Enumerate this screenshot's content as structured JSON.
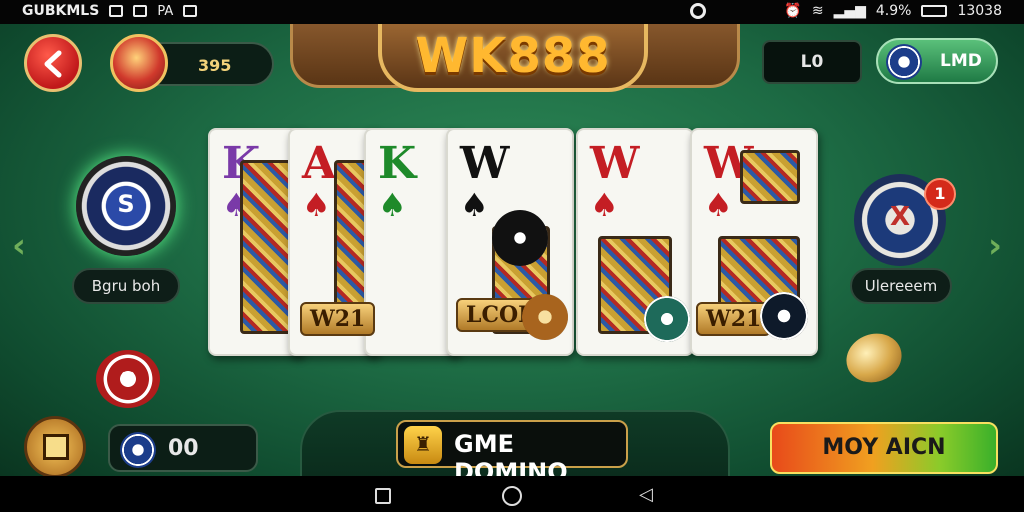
{
  "status_bar": {
    "carrier": "GUBKMLS",
    "center_icon": "circle-icon",
    "battery": "4.9%",
    "time": "13038"
  },
  "header": {
    "logo": "WK888",
    "coin_value": "395",
    "lo_label": "L0",
    "lmd_label": "LMD"
  },
  "side_left": {
    "chip_symbol": "S",
    "label": "Bgru boh"
  },
  "side_right": {
    "chip_symbol": "X",
    "badge_count": "1",
    "label": "Ulereeem"
  },
  "cards": [
    {
      "rank": "K",
      "suit": "♠",
      "rank_color": "#7a3aa8",
      "suit_color": "#7a3aa8"
    },
    {
      "rank": "A",
      "suit": "♠",
      "rank_color": "#c41e24",
      "suit_color": "#c41e24"
    },
    {
      "rank": "K",
      "suit": "♠",
      "rank_color": "#1e8a2a",
      "suit_color": "#1e8a2a"
    },
    {
      "rank": "W",
      "suit": "♠",
      "rank_color": "#111111",
      "suit_color": "#111111"
    },
    {
      "rank": "W",
      "suit": "♠",
      "rank_color": "#c41e24",
      "suit_color": "#c41e24"
    },
    {
      "rank": "W",
      "suit": "♠",
      "rank_color": "#c41e24",
      "suit_color": "#c41e24"
    }
  ],
  "card_tags": {
    "tag1": "W21",
    "tag2": "LCOR",
    "tag3": "W21"
  },
  "footer": {
    "balance": "00",
    "game_label": "GME DOMINO",
    "action_label": "MOY AICN"
  }
}
